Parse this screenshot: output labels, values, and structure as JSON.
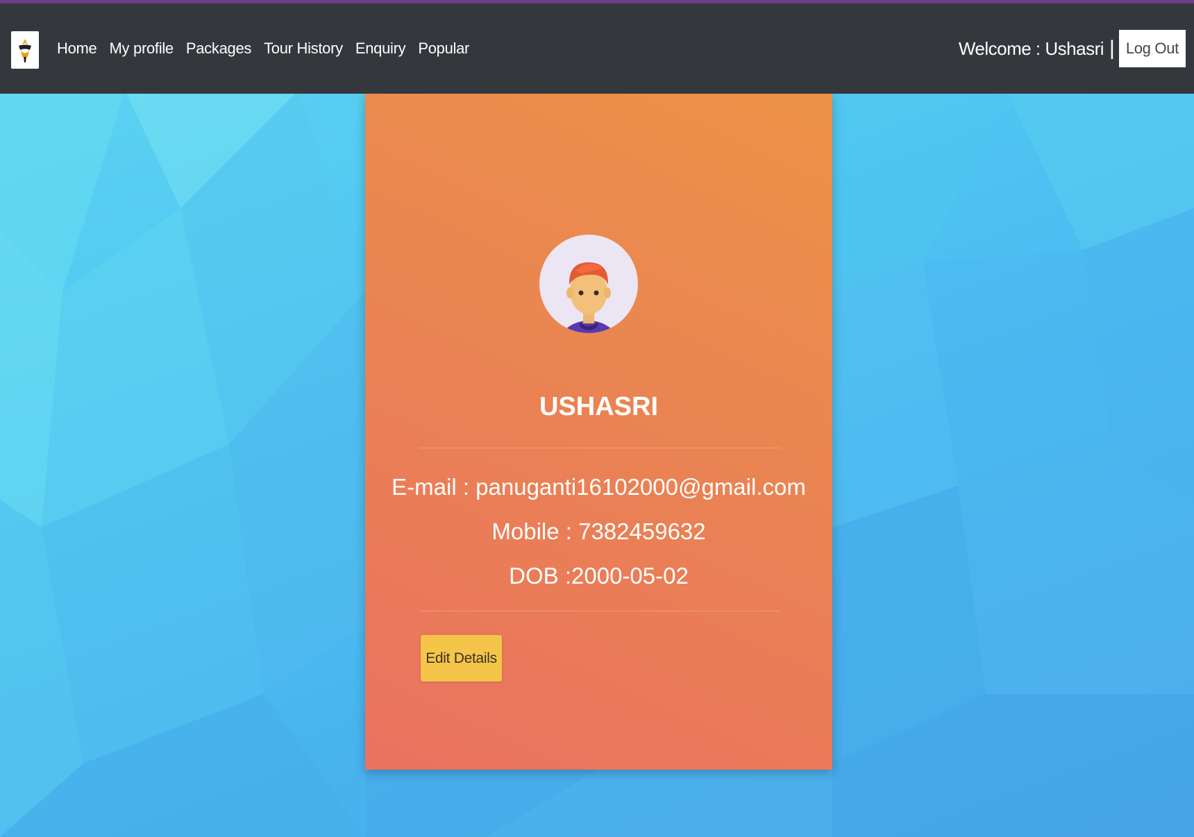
{
  "nav": {
    "links": [
      "Home",
      "My profile",
      "Packages",
      "Tour History",
      "Enquiry",
      "Popular"
    ],
    "welcome_text": "Welcome : Ushasri",
    "separator": "|",
    "logout_label": "Log Out"
  },
  "profile": {
    "name": "USHASRI",
    "email_line": "E-mail : panuganti16102000@gmail.com",
    "mobile_line": "Mobile : 7382459632",
    "dob_line": "DOB :2000-05-02",
    "edit_label": "Edit Details"
  },
  "icons": {
    "logo": "travel-logo-icon",
    "avatar": "user-avatar-icon"
  },
  "colors": {
    "navbar": "#34373c",
    "card_top": "#ec9247",
    "card_bottom": "#ea7260",
    "edit_button": "#f5c54a",
    "background": "#4fc6f2"
  }
}
